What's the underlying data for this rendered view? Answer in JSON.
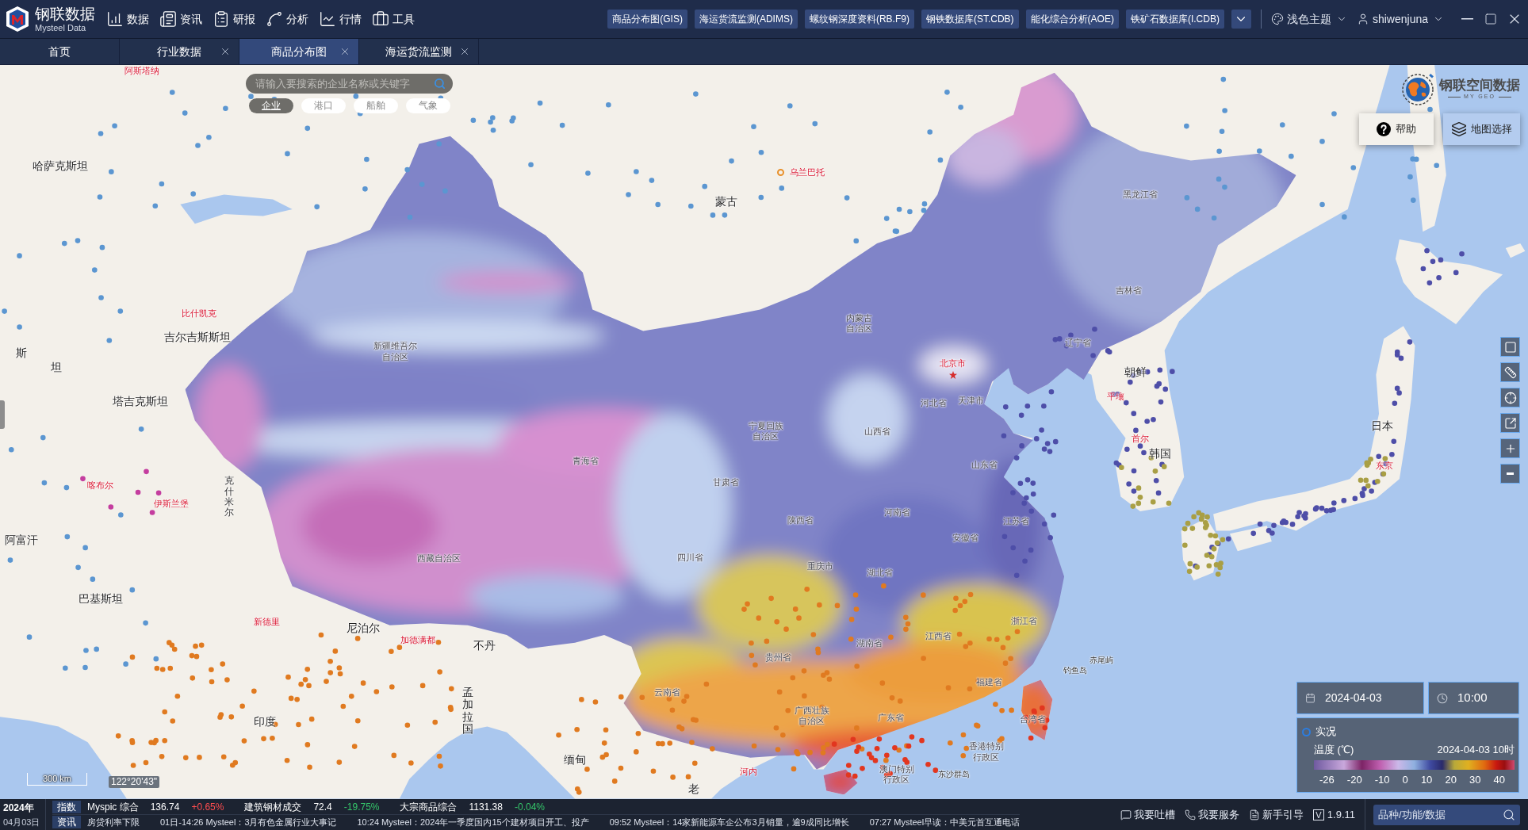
{
  "header": {
    "logo": {
      "name": "钢联数据",
      "subtitle": "Mysteel Data"
    },
    "nav": [
      "数据",
      "资讯",
      "研报",
      "分析",
      "行情",
      "工具"
    ],
    "quick_links": [
      "商品分布图(GIS)",
      "海运货流监测(ADIMS)",
      "螺纹钢深度资料(RB.F9)",
      "钢铁数据库(ST.CDB)",
      "能化综合分析(AOE)",
      "铁矿石数据库(I.CDB)"
    ],
    "theme": "浅色主题",
    "user": "shiwenjuna"
  },
  "tabs": [
    {
      "label": "首页",
      "selected": false,
      "closable": false
    },
    {
      "label": "行业数据",
      "selected": false,
      "closable": true
    },
    {
      "label": "商品分布图",
      "selected": true,
      "closable": true
    },
    {
      "label": "海运货流监测",
      "selected": false,
      "closable": true
    }
  ],
  "map": {
    "search": {
      "placeholder": "请输入要搜索的企业名称或关键字"
    },
    "filters": [
      {
        "label": "企业",
        "selected": true
      },
      {
        "label": "港口",
        "selected": false
      },
      {
        "label": "船舶",
        "selected": false
      },
      {
        "label": "气象",
        "selected": false
      }
    ],
    "brand": {
      "name": "钢联空间数据",
      "tagline": "MY GEO"
    },
    "buttons": [
      "帮助",
      "地图选择"
    ],
    "labels": [
      {
        "text": "阿斯塔纳",
        "kind": "capital"
      },
      {
        "text": "哈萨克斯坦",
        "kind": "country"
      },
      {
        "text": "乌兰巴托",
        "kind": "capital"
      },
      {
        "text": "蒙古",
        "kind": "country"
      },
      {
        "text": "黑龙江省",
        "kind": "province"
      },
      {
        "text": "吉林省",
        "kind": "province"
      },
      {
        "text": "比什凯克",
        "kind": "capital"
      },
      {
        "text": "内蒙古自治区",
        "kind": "province"
      },
      {
        "text": "吉尔吉斯斯坦",
        "kind": "country"
      },
      {
        "text": "斯",
        "kind": "country"
      },
      {
        "text": "坦",
        "kind": "country"
      },
      {
        "text": "新疆维吾尔自治区",
        "kind": "province"
      },
      {
        "text": "辽宁省",
        "kind": "province"
      },
      {
        "text": "北京市",
        "kind": "capital"
      },
      {
        "text": "朝鲜",
        "kind": "country"
      },
      {
        "text": "塔吉克斯坦",
        "kind": "country"
      },
      {
        "text": "河北省",
        "kind": "province"
      },
      {
        "text": "天津市",
        "kind": "province"
      },
      {
        "text": "平壤",
        "kind": "capital"
      },
      {
        "text": "宁夏回族自治区",
        "kind": "province"
      },
      {
        "text": "山西省",
        "kind": "province"
      },
      {
        "text": "日本",
        "kind": "country"
      },
      {
        "text": "首尔",
        "kind": "capital"
      },
      {
        "text": "青海省",
        "kind": "province"
      },
      {
        "text": "山东省",
        "kind": "province"
      },
      {
        "text": "韩国",
        "kind": "country"
      },
      {
        "text": "东京",
        "kind": "capital"
      },
      {
        "text": "喀布尔",
        "kind": "capital"
      },
      {
        "text": "伊斯兰堡",
        "kind": "capital"
      },
      {
        "text": "克什米尔",
        "kind": "region"
      },
      {
        "text": "甘肃省",
        "kind": "province"
      },
      {
        "text": "陕西省",
        "kind": "province"
      },
      {
        "text": "河南省",
        "kind": "province"
      },
      {
        "text": "江苏省",
        "kind": "province"
      },
      {
        "text": "阿富汗",
        "kind": "country"
      },
      {
        "text": "安徽省",
        "kind": "province"
      },
      {
        "text": "西藏自治区",
        "kind": "province"
      },
      {
        "text": "四川省",
        "kind": "province"
      },
      {
        "text": "重庆市",
        "kind": "province"
      },
      {
        "text": "湖北省",
        "kind": "province"
      },
      {
        "text": "巴基斯坦",
        "kind": "country"
      },
      {
        "text": "新德里",
        "kind": "capital"
      },
      {
        "text": "尼泊尔",
        "kind": "country"
      },
      {
        "text": "浙江省",
        "kind": "province"
      },
      {
        "text": "加德满都",
        "kind": "capital"
      },
      {
        "text": "不丹",
        "kind": "country"
      },
      {
        "text": "湖南省",
        "kind": "province"
      },
      {
        "text": "江西省",
        "kind": "province"
      },
      {
        "text": "贵州省",
        "kind": "province"
      },
      {
        "text": "赤尾屿",
        "kind": "island"
      },
      {
        "text": "钓鱼岛",
        "kind": "island"
      },
      {
        "text": "福建省",
        "kind": "province"
      },
      {
        "text": "印度",
        "kind": "country"
      },
      {
        "text": "孟加拉国",
        "kind": "country"
      },
      {
        "text": "云南省",
        "kind": "province"
      },
      {
        "text": "广西壮族自治区",
        "kind": "province"
      },
      {
        "text": "广东省",
        "kind": "province"
      },
      {
        "text": "台湾省",
        "kind": "province"
      },
      {
        "text": "缅甸",
        "kind": "country"
      },
      {
        "text": "香港特别行政区",
        "kind": "province"
      },
      {
        "text": "河内",
        "kind": "capital"
      },
      {
        "text": "澳门特别行政区",
        "kind": "province"
      },
      {
        "text": "东沙群岛",
        "kind": "island"
      },
      {
        "text": "老",
        "kind": "country"
      }
    ],
    "scale": "300 km",
    "coordinates": "122°20'43\"",
    "date": "2024-04-03",
    "time": "10:00",
    "legend": {
      "mode": {
        "label": "实况",
        "selected": false
      },
      "title": "温度 (℃)",
      "timestamp": "2024-04-03 10时",
      "ticks": [
        "-26",
        "-20",
        "-10",
        "0",
        "10",
        "20",
        "30",
        "40"
      ]
    }
  },
  "footer": {
    "date": {
      "year": "2024年",
      "day": "04月03日"
    },
    "indices": {
      "tag": "指数",
      "items": [
        {
          "name": "Myspic 综合",
          "value": "136.74",
          "change": "+0.65%",
          "rising": true
        },
        {
          "name": "建筑钢材成交",
          "value": "72.4",
          "change": "-19.75%",
          "rising": false
        },
        {
          "name": "大宗商品综合",
          "value": "1131.38",
          "change": "-0.04%",
          "rising": false
        }
      ]
    },
    "news": {
      "tag": "资讯",
      "items": [
        "房贷利率下限",
        "01日-14:26 Mysteel：3月有色金属行业大事记",
        "10:24 Mysteel：2024年一季度国内15个建材项目开工、投产",
        "09:52 Mysteel：14家新能源车企公布3月销量，逾9成同比增长",
        "07:27 Mysteel早读：中美元首互通电话"
      ]
    },
    "actions": [
      "我要吐槽",
      "我要服务",
      "新手引导"
    ],
    "version": {
      "badge": "V",
      "number": "1.9.11"
    },
    "search": {
      "placeholder": "品种/功能/数据"
    }
  }
}
